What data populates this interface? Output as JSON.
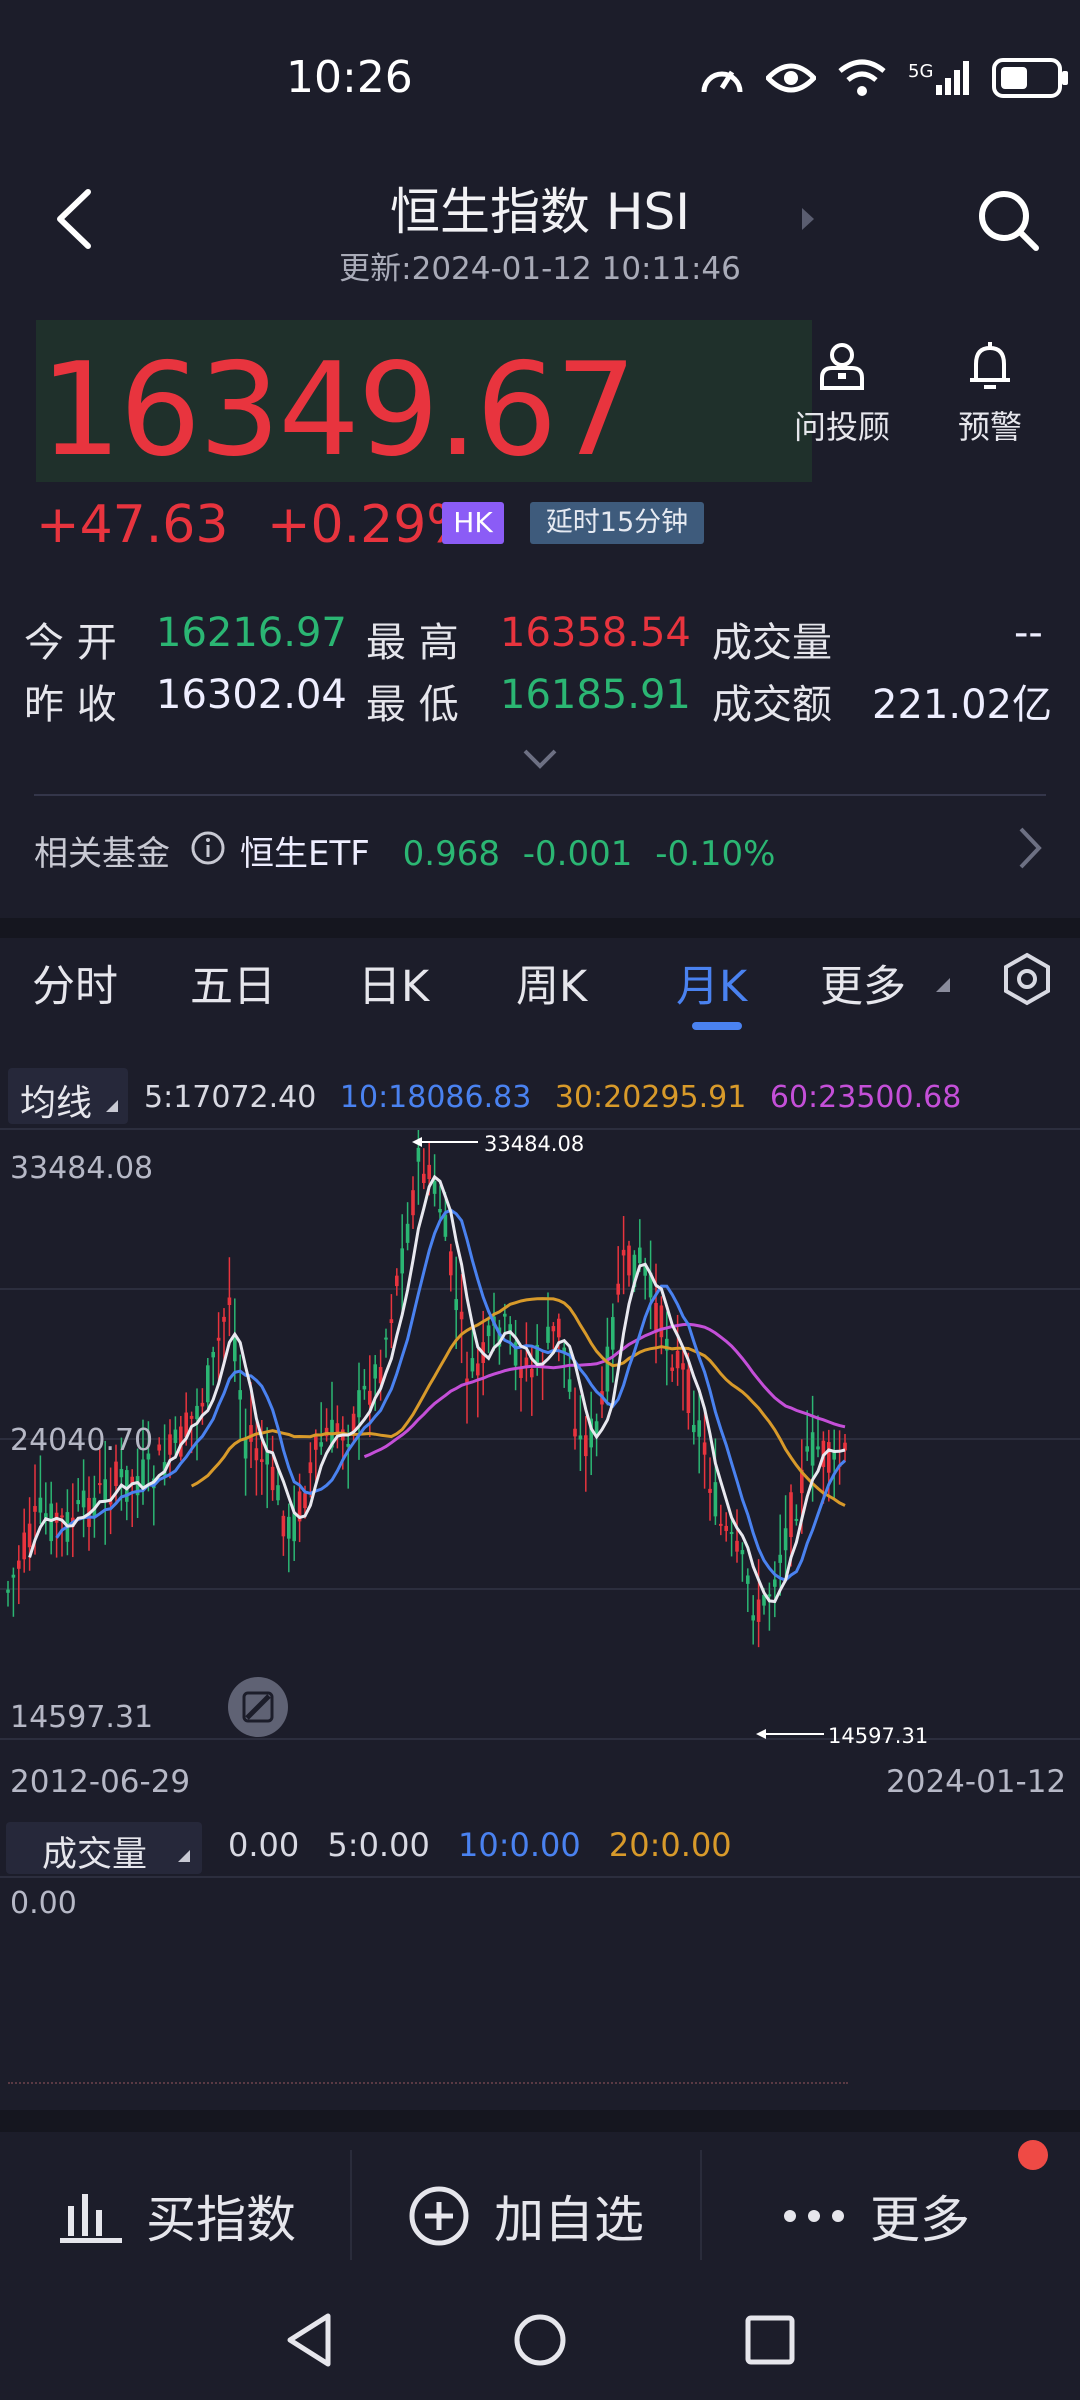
{
  "status": {
    "time": "10:26",
    "network": "5G"
  },
  "header": {
    "title": "恒生指数 HSI",
    "updated": "更新:2024-01-12 10:11:46"
  },
  "price": {
    "last": "16349.67",
    "change": "+47.63",
    "change_pct": "+0.29%",
    "market_badge": "HK",
    "delay_badge": "延时15分钟"
  },
  "actions": [
    {
      "label": "问投顾",
      "icon": "advisor-icon"
    },
    {
      "label": "预警",
      "icon": "bell-icon"
    }
  ],
  "quote": {
    "open_label": "今 开",
    "open": "16216.97",
    "high_label": "最 高",
    "high": "16358.54",
    "volume_label": "成交量",
    "volume": "--",
    "prev_close_label": "昨 收",
    "prev_close": "16302.04",
    "low_label": "最 低",
    "low": "16185.91",
    "turnover_label": "成交额",
    "turnover": "221.02亿"
  },
  "fund": {
    "label": "相关基金",
    "name": "恒生ETF",
    "price": "0.968",
    "change": "-0.001",
    "change_pct": "-0.10%"
  },
  "tabs": [
    "分时",
    "五日",
    "日K",
    "周K",
    "月K",
    "更多"
  ],
  "active_tab": "月K",
  "ma": {
    "selector": "均线",
    "ma5": "5:17072.40",
    "ma10": "10:18086.83",
    "ma30": "30:20295.91",
    "ma60": "60:23500.68"
  },
  "chart": {
    "y_high_label": "33484.08",
    "y_mid_label": "24040.70",
    "y_low_label": "14597.31",
    "max_marker": "33484.08",
    "min_marker": "14597.31",
    "x_start": "2012-06-29",
    "x_end": "2024-01-12",
    "colors": {
      "up": "#e8343e",
      "down": "#2bb673",
      "ma5": "#e8e8ef",
      "ma10": "#4a82f0",
      "ma30": "#d89a2a",
      "ma60": "#c44fd8"
    }
  },
  "volume": {
    "selector": "成交量",
    "value": "0.00",
    "ma5": "5:0.00",
    "ma10": "10:0.00",
    "ma20": "20:0.00",
    "axis_label": "0.00"
  },
  "bottom_bar": {
    "buy": "买指数",
    "watch": "加自选",
    "more": "更多"
  }
}
